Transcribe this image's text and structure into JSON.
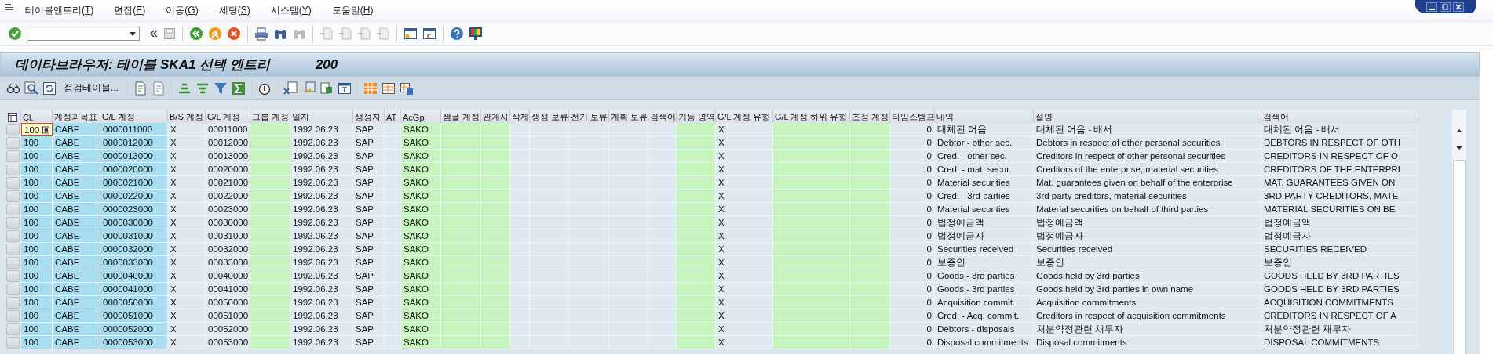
{
  "menu": [
    {
      "label": "테이블엔트리(",
      "mnemonic": "T",
      "close": ")"
    },
    {
      "label": "편집(",
      "mnemonic": "E",
      "close": ")"
    },
    {
      "label": "이동(",
      "mnemonic": "G",
      "close": ")"
    },
    {
      "label": "세팅(",
      "mnemonic": "S",
      "close": ")"
    },
    {
      "label": "시스템(",
      "mnemonic": "Y",
      "close": ")"
    },
    {
      "label": "도움말(",
      "mnemonic": "H",
      "close": ")"
    }
  ],
  "title": {
    "text": "데이타브라우저: 테이블 SKA1 선택 엔트리",
    "count": "200"
  },
  "app_toolbar": {
    "check_table_button": "점검테이블..."
  },
  "table": {
    "columns": [
      {
        "label": "Cl.",
        "kind": "key"
      },
      {
        "label": "계정과목표",
        "kind": "key"
      },
      {
        "label": "G/L 계정",
        "kind": "key"
      },
      {
        "label": "B/S 계정",
        "kind": "text"
      },
      {
        "label": "G/L 계정",
        "kind": "text"
      },
      {
        "label": "그룹 계정",
        "kind": "input"
      },
      {
        "label": "일자",
        "kind": "text"
      },
      {
        "label": "생성자",
        "kind": "text"
      },
      {
        "label": "AT",
        "kind": "text"
      },
      {
        "label": "AcGp",
        "kind": "input"
      },
      {
        "label": "샘플 계정",
        "kind": "input"
      },
      {
        "label": "관계사",
        "kind": "input"
      },
      {
        "label": "삭제",
        "kind": "text"
      },
      {
        "label": "생성 보류",
        "kind": "text"
      },
      {
        "label": "전기 보류",
        "kind": "text"
      },
      {
        "label": "계획 보류",
        "kind": "text"
      },
      {
        "label": "검색어",
        "kind": "text"
      },
      {
        "label": "기능 영역",
        "kind": "input"
      },
      {
        "label": "G/L 계정 유형",
        "kind": "text"
      },
      {
        "label": "G/L 계정 하위 유형",
        "kind": "input"
      },
      {
        "label": "조정 계정",
        "kind": "input"
      },
      {
        "label": "타임스탬프",
        "kind": "number"
      },
      {
        "label": "내역",
        "kind": "text"
      },
      {
        "label": "설명",
        "kind": "text"
      },
      {
        "label": "검색어",
        "kind": "text"
      }
    ],
    "rows": [
      {
        "focused": true,
        "cells": [
          "100",
          "CABE",
          "0000011000",
          "X",
          "00011000",
          null,
          "1992.06.23",
          "SAP",
          null,
          "SAKO",
          null,
          null,
          null,
          null,
          null,
          null,
          null,
          null,
          "X",
          null,
          null,
          "0",
          "대체된 어음",
          "대체된 어음 - 배서",
          "대체된 어음 - 배서"
        ]
      },
      {
        "focused": false,
        "cells": [
          "100",
          "CABE",
          "0000012000",
          "X",
          "00012000",
          null,
          "1992.06.23",
          "SAP",
          null,
          "SAKO",
          null,
          null,
          null,
          null,
          null,
          null,
          null,
          null,
          "X",
          null,
          null,
          "0",
          "Debtor - other sec.",
          "Debtors in respect of other personal securities",
          "DEBTORS IN RESPECT OF OTH"
        ]
      },
      {
        "focused": false,
        "cells": [
          "100",
          "CABE",
          "0000013000",
          "X",
          "00013000",
          null,
          "1992.06.23",
          "SAP",
          null,
          "SAKO",
          null,
          null,
          null,
          null,
          null,
          null,
          null,
          null,
          "X",
          null,
          null,
          "0",
          "Cred. - other sec.",
          "Creditors in respect of other personal securities",
          "CREDITORS IN RESPECT OF O"
        ]
      },
      {
        "focused": false,
        "cells": [
          "100",
          "CABE",
          "0000020000",
          "X",
          "00020000",
          null,
          "1992.06.23",
          "SAP",
          null,
          "SAKO",
          null,
          null,
          null,
          null,
          null,
          null,
          null,
          null,
          "X",
          null,
          null,
          "0",
          "Cred. - mat. secur.",
          "Creditors of the enterprise, material securities",
          "CREDITORS OF THE ENTERPRI"
        ]
      },
      {
        "focused": false,
        "cells": [
          "100",
          "CABE",
          "0000021000",
          "X",
          "00021000",
          null,
          "1992.06.23",
          "SAP",
          null,
          "SAKO",
          null,
          null,
          null,
          null,
          null,
          null,
          null,
          null,
          "X",
          null,
          null,
          "0",
          "Material securities",
          "Mat. guarantees given on behalf of the enterprise",
          "MAT. GUARANTEES GIVEN ON"
        ]
      },
      {
        "focused": false,
        "cells": [
          "100",
          "CABE",
          "0000022000",
          "X",
          "00022000",
          null,
          "1992.06.23",
          "SAP",
          null,
          "SAKO",
          null,
          null,
          null,
          null,
          null,
          null,
          null,
          null,
          "X",
          null,
          null,
          "0",
          "Cred. - 3rd parties",
          "3rd party creditors, material securities",
          "3RD PARTY CREDITORS, MATE"
        ]
      },
      {
        "focused": false,
        "cells": [
          "100",
          "CABE",
          "0000023000",
          "X",
          "00023000",
          null,
          "1992.06.23",
          "SAP",
          null,
          "SAKO",
          null,
          null,
          null,
          null,
          null,
          null,
          null,
          null,
          "X",
          null,
          null,
          "0",
          "Material securities",
          "Material securities on behalf of third parties",
          "MATERIAL SECURITIES ON BE"
        ]
      },
      {
        "focused": false,
        "cells": [
          "100",
          "CABE",
          "0000030000",
          "X",
          "00030000",
          null,
          "1992.06.23",
          "SAP",
          null,
          "SAKO",
          null,
          null,
          null,
          null,
          null,
          null,
          null,
          null,
          "X",
          null,
          null,
          "0",
          "법정예금액",
          "법정예금액",
          "법정예금액"
        ]
      },
      {
        "focused": false,
        "cells": [
          "100",
          "CABE",
          "0000031000",
          "X",
          "00031000",
          null,
          "1992.06.23",
          "SAP",
          null,
          "SAKO",
          null,
          null,
          null,
          null,
          null,
          null,
          null,
          null,
          "X",
          null,
          null,
          "0",
          "법정예금자",
          "법정예금자",
          "법정예금자"
        ]
      },
      {
        "focused": false,
        "cells": [
          "100",
          "CABE",
          "0000032000",
          "X",
          "00032000",
          null,
          "1992.06.23",
          "SAP",
          null,
          "SAKO",
          null,
          null,
          null,
          null,
          null,
          null,
          null,
          null,
          "X",
          null,
          null,
          "0",
          "Securities received",
          "Securities received",
          "SECURITIES RECEIVED"
        ]
      },
      {
        "focused": false,
        "cells": [
          "100",
          "CABE",
          "0000033000",
          "X",
          "00033000",
          null,
          "1992.06.23",
          "SAP",
          null,
          "SAKO",
          null,
          null,
          null,
          null,
          null,
          null,
          null,
          null,
          "X",
          null,
          null,
          "0",
          "보증인",
          "보증인",
          "보증인"
        ]
      },
      {
        "focused": false,
        "cells": [
          "100",
          "CABE",
          "0000040000",
          "X",
          "00040000",
          null,
          "1992.06.23",
          "SAP",
          null,
          "SAKO",
          null,
          null,
          null,
          null,
          null,
          null,
          null,
          null,
          "X",
          null,
          null,
          "0",
          "Goods - 3rd parties",
          "Goods held by 3rd parties",
          "GOODS HELD BY 3RD PARTIES"
        ]
      },
      {
        "focused": false,
        "cells": [
          "100",
          "CABE",
          "0000041000",
          "X",
          "00041000",
          null,
          "1992.06.23",
          "SAP",
          null,
          "SAKO",
          null,
          null,
          null,
          null,
          null,
          null,
          null,
          null,
          "X",
          null,
          null,
          "0",
          "Goods - 3rd parties",
          "Goods held by 3rd parties in own name",
          "GOODS HELD BY 3RD PARTIES"
        ]
      },
      {
        "focused": false,
        "cells": [
          "100",
          "CABE",
          "0000050000",
          "X",
          "00050000",
          null,
          "1992.06.23",
          "SAP",
          null,
          "SAKO",
          null,
          null,
          null,
          null,
          null,
          null,
          null,
          null,
          "X",
          null,
          null,
          "0",
          "Acquisition commit.",
          "Acquisition commitments",
          "ACQUISITION COMMITMENTS"
        ]
      },
      {
        "focused": false,
        "cells": [
          "100",
          "CABE",
          "0000051000",
          "X",
          "00051000",
          null,
          "1992.06.23",
          "SAP",
          null,
          "SAKO",
          null,
          null,
          null,
          null,
          null,
          null,
          null,
          null,
          "X",
          null,
          null,
          "0",
          "Cred. - Acq. commit.",
          "Creditors in respect of acquisition commitments",
          "CREDITORS IN RESPECT OF A"
        ]
      },
      {
        "focused": false,
        "cells": [
          "100",
          "CABE",
          "0000052000",
          "X",
          "00052000",
          null,
          "1992.06.23",
          "SAP",
          null,
          "SAKO",
          null,
          null,
          null,
          null,
          null,
          null,
          null,
          null,
          "X",
          null,
          null,
          "0",
          "Debtors - disposals",
          "처분약정관련 채무자",
          "처분약정관련 채무자"
        ]
      },
      {
        "focused": false,
        "cells": [
          "100",
          "CABE",
          "0000053000",
          "X",
          "00053000",
          null,
          "1992.06.23",
          "SAP",
          null,
          "SAKO",
          null,
          null,
          null,
          null,
          null,
          null,
          null,
          null,
          "X",
          null,
          null,
          "0",
          "Disposal commitments",
          "Disposal commitments",
          "DISPOSAL COMMITMENTS"
        ]
      }
    ]
  }
}
